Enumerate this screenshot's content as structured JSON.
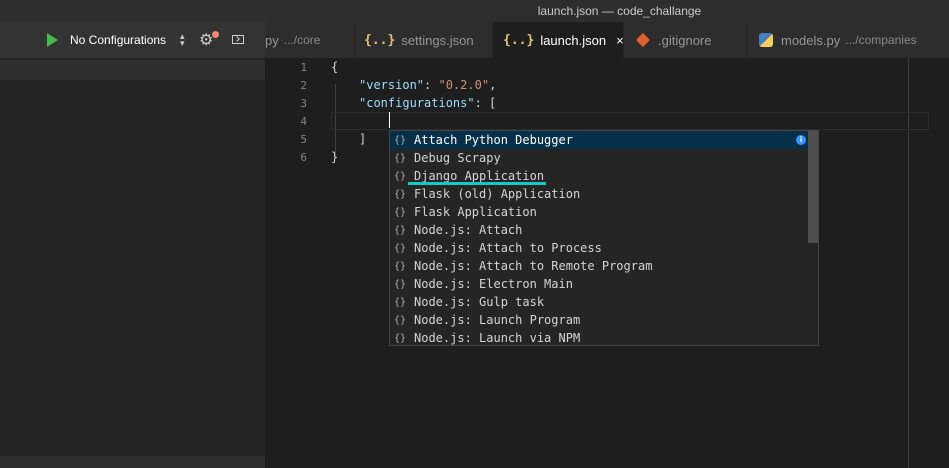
{
  "window": {
    "title": "launch.json — code_challange"
  },
  "debug": {
    "config_label": "No Configurations"
  },
  "tabs": [
    {
      "label": "py",
      "sub": ".../core",
      "icon": "python-icon"
    },
    {
      "label": "settings.json",
      "icon": "json-braces-icon",
      "glyph": "{..}"
    },
    {
      "label": "launch.json",
      "icon": "json-braces-icon",
      "glyph": "{..}",
      "active": true,
      "close": "×"
    },
    {
      "label": ".gitignore",
      "icon": "git-icon"
    },
    {
      "label": "models.py",
      "sub": ".../companies",
      "icon": "python-icon"
    }
  ],
  "editor": {
    "line_numbers": [
      "1",
      "2",
      "3",
      "4",
      "5",
      "6"
    ],
    "lines": {
      "l1": "{",
      "l2_key": "\"version\"",
      "l2_sep": ": ",
      "l2_val": "\"0.2.0\"",
      "l2_end": ",",
      "l3_key": "\"configurations\"",
      "l3_sep": ": [",
      "l5": "]",
      "l6": "}"
    }
  },
  "suggestions": {
    "icon_glyph": "{}",
    "info_glyph": "i",
    "items": [
      "Attach Python Debugger",
      "Debug Scrapy",
      "Django Application",
      "Flask (old) Application",
      "Flask Application",
      "Node.js: Attach",
      "Node.js: Attach to Process",
      "Node.js: Attach to Remote Program",
      "Node.js: Electron Main",
      "Node.js: Gulp task",
      "Node.js: Launch Program",
      "Node.js: Launch via NPM"
    ],
    "selected_index": 0,
    "highlighted_item": "Django Application",
    "highlight_color": "#17c9c3"
  }
}
